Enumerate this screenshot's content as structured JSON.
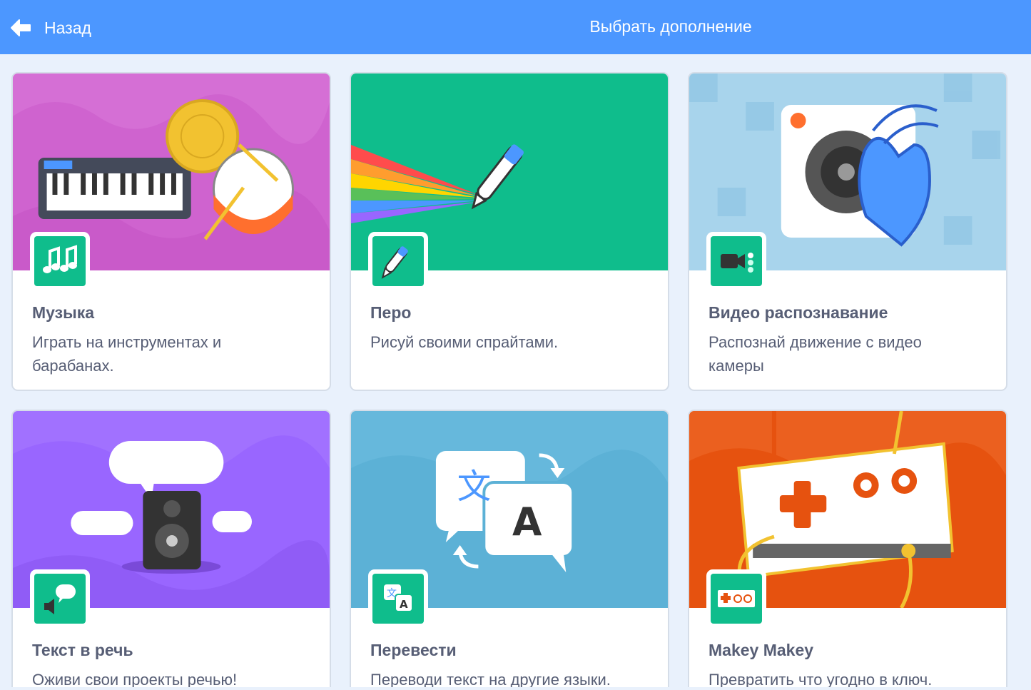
{
  "header": {
    "back_label": "Назад",
    "title": "Выбрать дополнение"
  },
  "extensions": [
    {
      "name": "Музыка",
      "description": "Играть на инструментах и барабанах.",
      "banner": "music",
      "icon": "music-notes-icon",
      "banner_color": "#cf63cf"
    },
    {
      "name": "Перо",
      "description": "Рисуй своими спрайтами.",
      "banner": "pen",
      "icon": "pen-icon",
      "banner_color": "#0fbd8c"
    },
    {
      "name": "Видео распознавание",
      "description": "Распознай движение с видео камеры",
      "banner": "video",
      "icon": "video-camera-icon",
      "banner_color": "#a8d4ec"
    },
    {
      "name": "Текст в речь",
      "description": "Оживи свои проекты речью!",
      "banner": "text2speech",
      "icon": "speaker-bubble-icon",
      "banner_color": "#9966ff"
    },
    {
      "name": "Перевести",
      "description": "Переводи текст на другие языки.",
      "banner": "translate",
      "icon": "translate-icon",
      "banner_color": "#5cb1d6"
    },
    {
      "name": "Makey Makey",
      "description": "Превратить что угодно в ключ.",
      "banner": "makeymakey",
      "icon": "makey-makey-icon",
      "banner_color": "#e6520f"
    }
  ],
  "colors": {
    "header": "#4c97ff",
    "background": "#e9f1fc",
    "icon_tile": "#0fbd8c",
    "text": "#575e75"
  }
}
